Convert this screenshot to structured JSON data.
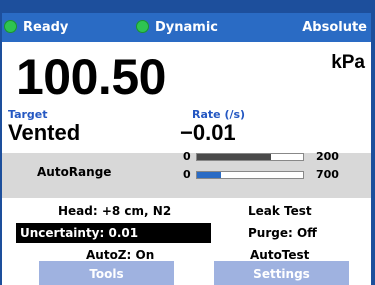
{
  "status": {
    "ready_label": "Ready",
    "mode_label": "Dynamic",
    "reference_label": "Absolute",
    "led_color": "#2ec451"
  },
  "reading": {
    "value": "100.50",
    "unit": "kPa"
  },
  "target": {
    "label": "Target",
    "value": "Vented"
  },
  "rate": {
    "label": "Rate (/s)",
    "value": "−0.01"
  },
  "autorange": {
    "label": "AutoRange",
    "bars": [
      {
        "min": "0",
        "max": "200",
        "fill_fraction": 0.7,
        "color": "#4a4a4a"
      },
      {
        "min": "0",
        "max": "700",
        "fill_fraction": 0.23,
        "color": "#2a6bc4"
      }
    ]
  },
  "info": {
    "head": "Head: +8 cm, N2",
    "uncertainty": "Uncertainty: 0.01",
    "autozero": "AutoZ: On",
    "leak_test": "Leak Test",
    "purge": "Purge: Off",
    "autotest": "AutoTest"
  },
  "softkeys": {
    "tools": "Tools",
    "settings": "Settings"
  }
}
